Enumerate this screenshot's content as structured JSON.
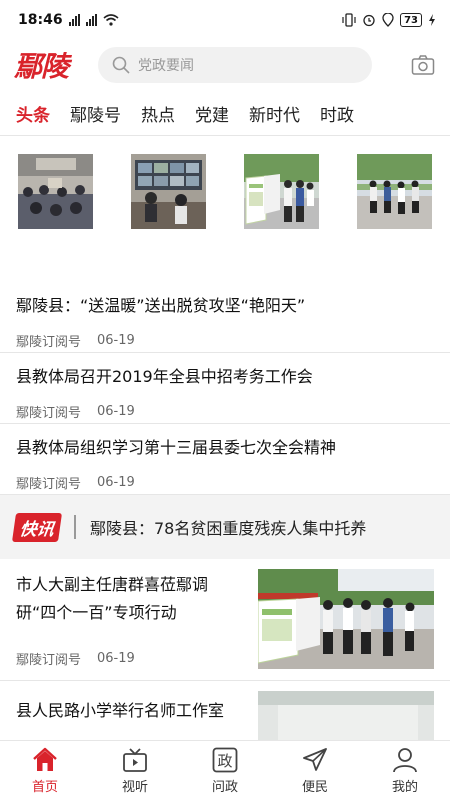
{
  "status": {
    "time": "18:46",
    "battery": "73"
  },
  "header": {
    "logo": "鄢陵",
    "search_placeholder": "党政要闻"
  },
  "tabs": [
    {
      "label": "头条",
      "active": true
    },
    {
      "label": "鄢陵号"
    },
    {
      "label": "热点"
    },
    {
      "label": "党建"
    },
    {
      "label": "新时代"
    },
    {
      "label": "时政"
    }
  ],
  "gallery": [
    {
      "icon": "meeting-photo"
    },
    {
      "icon": "monitor-room-photo"
    },
    {
      "icon": "outdoor-display-photo"
    },
    {
      "icon": "outdoor-street-photo"
    }
  ],
  "news": [
    {
      "title": "鄢陵县：“送温暖”送出脱贫攻坚“艳阳天”",
      "source": "鄢陵订阅号",
      "date": "06-19"
    },
    {
      "title": "县教体局召开2019年全县中招考务工作会",
      "source": "鄢陵订阅号",
      "date": "06-19"
    },
    {
      "title": "县教体局组织学习第十三届县委七次全会精神",
      "source": "鄢陵订阅号",
      "date": "06-19"
    }
  ],
  "flash": {
    "badge": "快讯",
    "text": "鄢陵县：78名贫困重度残疾人集中托养"
  },
  "image_news": [
    {
      "title": "市人大副主任唐群喜莅鄢调研“四个一百”专项行动",
      "source": "鄢陵订阅号",
      "date": "06-19"
    },
    {
      "title": "县人民路小学举行名师工作室"
    }
  ],
  "bottom_nav": [
    {
      "label": "首页",
      "icon": "home-icon",
      "active": true
    },
    {
      "label": "视听",
      "icon": "tv-icon"
    },
    {
      "label": "问政",
      "icon": "zheng-icon",
      "glyph": "政"
    },
    {
      "label": "便民",
      "icon": "send-icon"
    },
    {
      "label": "我的",
      "icon": "user-icon"
    }
  ],
  "colors": {
    "accent": "#d9232b",
    "gray_bg": "#f3f3f3"
  }
}
